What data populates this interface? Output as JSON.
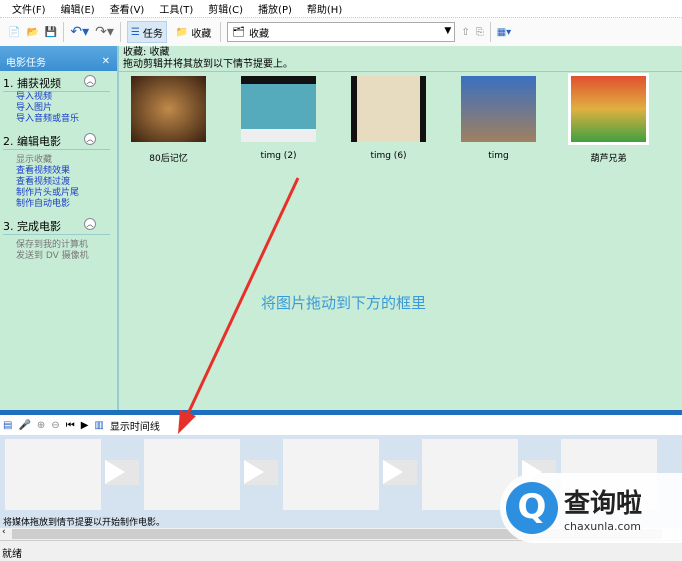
{
  "menu": [
    "文件(F)",
    "编辑(E)",
    "查看(V)",
    "工具(T)",
    "剪辑(C)",
    "播放(P)",
    "帮助(H)"
  ],
  "toolbar": {
    "tasks": "任务",
    "collections": "收藏",
    "combo_value": "收藏"
  },
  "left_panel": {
    "title": "电影任务",
    "sections": [
      {
        "title": "1. 捕获视频",
        "items": [
          {
            "label": "导入视频",
            "enabled": true
          },
          {
            "label": "导入图片",
            "enabled": true
          },
          {
            "label": "导入音频或音乐",
            "enabled": true
          }
        ]
      },
      {
        "title": "2. 编辑电影",
        "items": [
          {
            "label": "显示收藏",
            "enabled": false
          },
          {
            "label": "查看视频效果",
            "enabled": true
          },
          {
            "label": "查看视频过渡",
            "enabled": true
          },
          {
            "label": "制作片头或片尾",
            "enabled": true
          },
          {
            "label": "制作自动电影",
            "enabled": true
          }
        ]
      },
      {
        "title": "3. 完成电影",
        "items": [
          {
            "label": "保存到我的计算机",
            "enabled": false
          },
          {
            "label": "发送到 DV 摄像机",
            "enabled": false
          }
        ]
      }
    ]
  },
  "content": {
    "title": "收藏: 收藏",
    "subtitle": "拖动剪辑并将其放到以下情节提要上。",
    "clips": [
      {
        "name": "80后记忆"
      },
      {
        "name": "timg (2)"
      },
      {
        "name": "timg (6)"
      },
      {
        "name": "timg"
      },
      {
        "name": "葫芦兄弟",
        "selected": true
      }
    ],
    "annotation": "将图片拖动到下方的框里"
  },
  "storyboard": {
    "show_timeline": "显示时间线",
    "message": "将媒体拖放到情节提要以开始制作电影。"
  },
  "status": "就绪",
  "watermark": {
    "name": "查询啦",
    "url": "chaxunla.com"
  }
}
